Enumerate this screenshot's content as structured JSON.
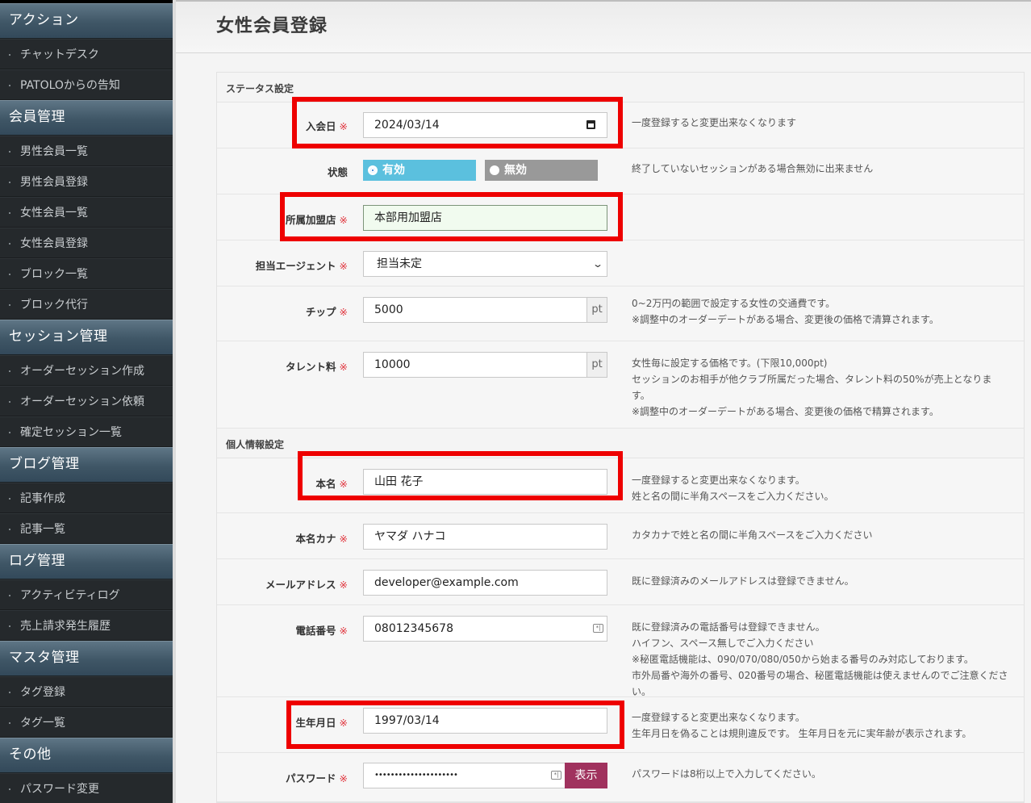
{
  "sidebar": {
    "sections": [
      {
        "title": "アクション",
        "items": [
          "チャットデスク",
          "PATOLOからの告知"
        ]
      },
      {
        "title": "会員管理",
        "items": [
          "男性会員一覧",
          "男性会員登録",
          "女性会員一覧",
          "女性会員登録",
          "ブロック一覧",
          "ブロック代行"
        ]
      },
      {
        "title": "セッション管理",
        "items": [
          "オーダーセッション作成",
          "オーダーセッション依頼",
          "確定セッション一覧"
        ]
      },
      {
        "title": "ブログ管理",
        "items": [
          "記事作成",
          "記事一覧"
        ]
      },
      {
        "title": "ログ管理",
        "items": [
          "アクティビティログ",
          "売上請求発生履歴"
        ]
      },
      {
        "title": "マスタ管理",
        "items": [
          "タグ登録",
          "タグ一覧"
        ]
      },
      {
        "title": "その他",
        "items": [
          "パスワード変更"
        ]
      }
    ]
  },
  "page": {
    "title": "女性会員登録"
  },
  "required_mark": "※",
  "status_section": {
    "heading": "ステータス設定",
    "join_date": {
      "label": "入会日",
      "value": "2024/03/14",
      "note": [
        "一度登録すると変更出来なくなります"
      ]
    },
    "state": {
      "label": "状態",
      "options": [
        {
          "label": "有効",
          "selected": true
        },
        {
          "label": "無効",
          "selected": false
        }
      ],
      "note": [
        "終了していないセッションがある場合無効に出来ません"
      ]
    },
    "store": {
      "label": "所属加盟店",
      "value": "本部用加盟店"
    },
    "agent": {
      "label": "担当エージェント",
      "value": "担当未定"
    },
    "tip": {
      "label": "チップ",
      "value": "5000",
      "unit": "pt",
      "note": [
        "0~2万円の範囲で設定する女性の交通費です。",
        "※調整中のオーダーデートがある場合、変更後の価格で清算されます。"
      ]
    },
    "talent_fee": {
      "label": "タレント料",
      "value": "10000",
      "unit": "pt",
      "note": [
        "女性毎に設定する価格です。(下限10,000pt)",
        "セッションのお相手が他クラブ所属だった場合、タレント料の50%が売上となります。",
        "※調整中のオーダーデートがある場合、変更後の価格で精算されます。"
      ]
    }
  },
  "personal_section": {
    "heading": "個人情報設定",
    "real_name": {
      "label": "本名",
      "value": "山田 花子",
      "note": [
        "一度登録すると変更出来なくなります。",
        "姓と名の間に半角スペースをご入力ください。"
      ]
    },
    "real_name_kana": {
      "label": "本名カナ",
      "value": "ヤマダ ハナコ",
      "note": [
        "カタカナで姓と名の間に半角スペースをご入力ください"
      ]
    },
    "email": {
      "label": "メールアドレス",
      "value": "developer@example.com",
      "note": [
        "既に登録済みのメールアドレスは登録できません。"
      ]
    },
    "phone": {
      "label": "電話番号",
      "value": "08012345678",
      "note": [
        "既に登録済みの電話番号は登録できません。",
        "ハイフン、スペース無しでご入力ください",
        "※秘匿電話機能は、090/070/080/050から始まる番号のみ対応しております。",
        "市外局番や海外の番号、020番号の場合、秘匿電話機能は使えませんのでご注意ください。"
      ]
    },
    "birthday": {
      "label": "生年月日",
      "value": "1997/03/14",
      "note": [
        "一度登録すると変更出来なくなります。",
        "生年月日を偽ることは規則違反です。 生年月日を元に実年齢が表示されます。"
      ]
    },
    "password": {
      "label": "パスワード",
      "value": "•••••••••••••••••••••",
      "show_label": "表示",
      "note": [
        "パスワードは8桁以上で入力してください。"
      ]
    }
  },
  "colors": {
    "highlight": "#ee0000",
    "active_radio": "#5bc0de",
    "inactive_radio": "#999999",
    "show_button": "#a0325e",
    "required": "#e0323b"
  }
}
